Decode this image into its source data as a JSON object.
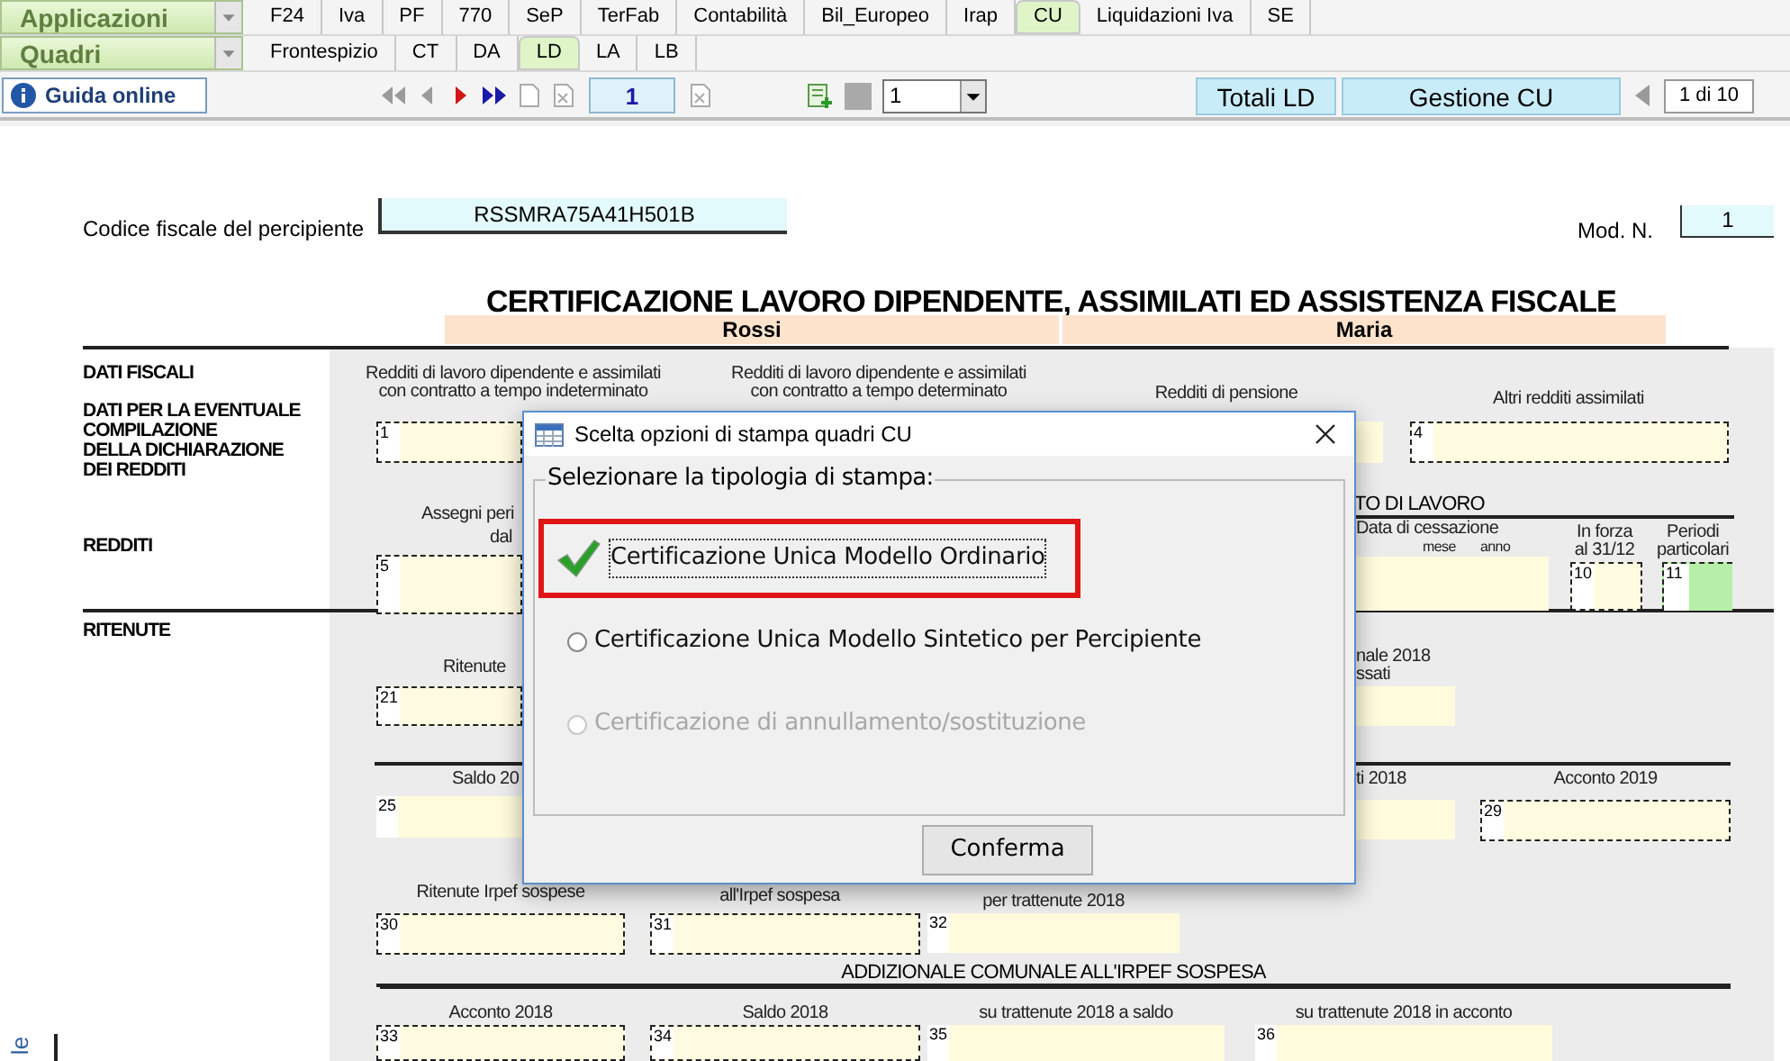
{
  "menu_rows": [
    {
      "dropdown": "Applicazioni",
      "tabs": [
        {
          "label": "F24",
          "selected": false
        },
        {
          "label": "Iva",
          "selected": false
        },
        {
          "label": "PF",
          "selected": false
        },
        {
          "label": "770",
          "selected": false
        },
        {
          "label": "SeP",
          "selected": false
        },
        {
          "label": "TerFab",
          "selected": false
        },
        {
          "label": "Contabilità",
          "selected": false
        },
        {
          "label": "Bil_Europeo",
          "selected": false
        },
        {
          "label": "Irap",
          "selected": false
        },
        {
          "label": "CU",
          "selected": true
        },
        {
          "label": "Liquidazioni Iva",
          "selected": false
        },
        {
          "label": "SE",
          "selected": false
        }
      ]
    },
    {
      "dropdown": "Quadri",
      "tabs": [
        {
          "label": "Frontespizio",
          "selected": false
        },
        {
          "label": "CT",
          "selected": false
        },
        {
          "label": "DA",
          "selected": false
        },
        {
          "label": "LD",
          "selected": true
        },
        {
          "label": "LA",
          "selected": false
        },
        {
          "label": "LB",
          "selected": false
        }
      ]
    }
  ],
  "toolbar": {
    "help_button": "Guida online",
    "page_field": "1",
    "select_value": "1",
    "buttons": [
      "Totali LD",
      "Gestione CU"
    ],
    "page_count": "1 di 10"
  },
  "form": {
    "fiscal_code_label": "Codice fiscale del percipiente",
    "fiscal_code": "RSSMRA75A41H501B",
    "mod_label": "Mod. N.",
    "mod_number": "1",
    "title": "CERTIFICAZIONE LAVORO DIPENDENTE, ASSIMILATI ED ASSISTENZA FISCALE",
    "surname": "Rossi",
    "name": "Maria",
    "side_label": "le",
    "section_labels": [
      "DATI FISCALI",
      "DATI PER LA EVENTUALE\nCOMPILAZIONE\nDELLA DICHIARAZIONE\nDEI REDDITI",
      "REDDITI",
      "RITENUTE"
    ],
    "captions": [
      "Redditi di lavoro dipendente e assimilati\ncon contratto a tempo indeterminato",
      "Redditi di lavoro dipendente e assimilati\ncon contratto a tempo determinato",
      "Redditi di pensione",
      "Altri redditi assimilati",
      "Assegni peri",
      "dal",
      "Data di cessazione",
      "mese",
      "anno",
      "In forza\nal 31/12",
      "Periodi\nparticolari",
      "Ritenute",
      "nale 2018\nssati",
      "Saldo 20",
      "ti 2018",
      "Acconto 2019",
      "Ritenute Irpef sospese",
      "all'Irpef sospesa",
      "per trattenute 2018",
      "Acconto 2018",
      "Saldo 2018",
      "su trattenute 2018 a saldo",
      "su trattenute 2018 in acconto"
    ],
    "headings": [
      "TO DI LAVORO",
      "ADDIZIONALE COMUNALE ALL'IRPEF SOSPESA"
    ],
    "boxes": [
      {
        "number": "1",
        "kind": "dashed"
      },
      {
        "number": "4",
        "kind": "dashed"
      },
      {
        "number": "5",
        "kind": "dashed"
      },
      {
        "number": "10",
        "kind": "dashed"
      },
      {
        "number": "11",
        "kind": "flag"
      },
      {
        "number": "21",
        "kind": "dashed"
      },
      {
        "number": "25",
        "kind": "plain"
      },
      {
        "number": "29",
        "kind": "dashed"
      },
      {
        "number": "30",
        "kind": "dashed"
      },
      {
        "number": "31",
        "kind": "dashed"
      },
      {
        "number": "32",
        "kind": "plain"
      },
      {
        "number": "33",
        "kind": "dashed"
      },
      {
        "number": "34",
        "kind": "dashed"
      },
      {
        "number": "35",
        "kind": "plain"
      },
      {
        "number": "36",
        "kind": "plain"
      },
      {
        "kind": "plain"
      },
      {
        "kind": "plain"
      },
      {
        "kind": "plain"
      },
      {
        "kind": "plain"
      }
    ]
  },
  "dialog": {
    "title": "Scelta opzioni di stampa quadri CU",
    "group_label": "Selezionare la tipologia di stampa:",
    "options": [
      {
        "label": "Certificazione Unica Modello Ordinario",
        "selected": true,
        "disabled": false
      },
      {
        "label": "Certificazione Unica Modello Sintetico per Percipiente",
        "selected": false,
        "disabled": false
      },
      {
        "label": "Certificazione di annullamento/sostituzione",
        "selected": false,
        "disabled": true
      }
    ],
    "confirm_button": "Conferma"
  }
}
